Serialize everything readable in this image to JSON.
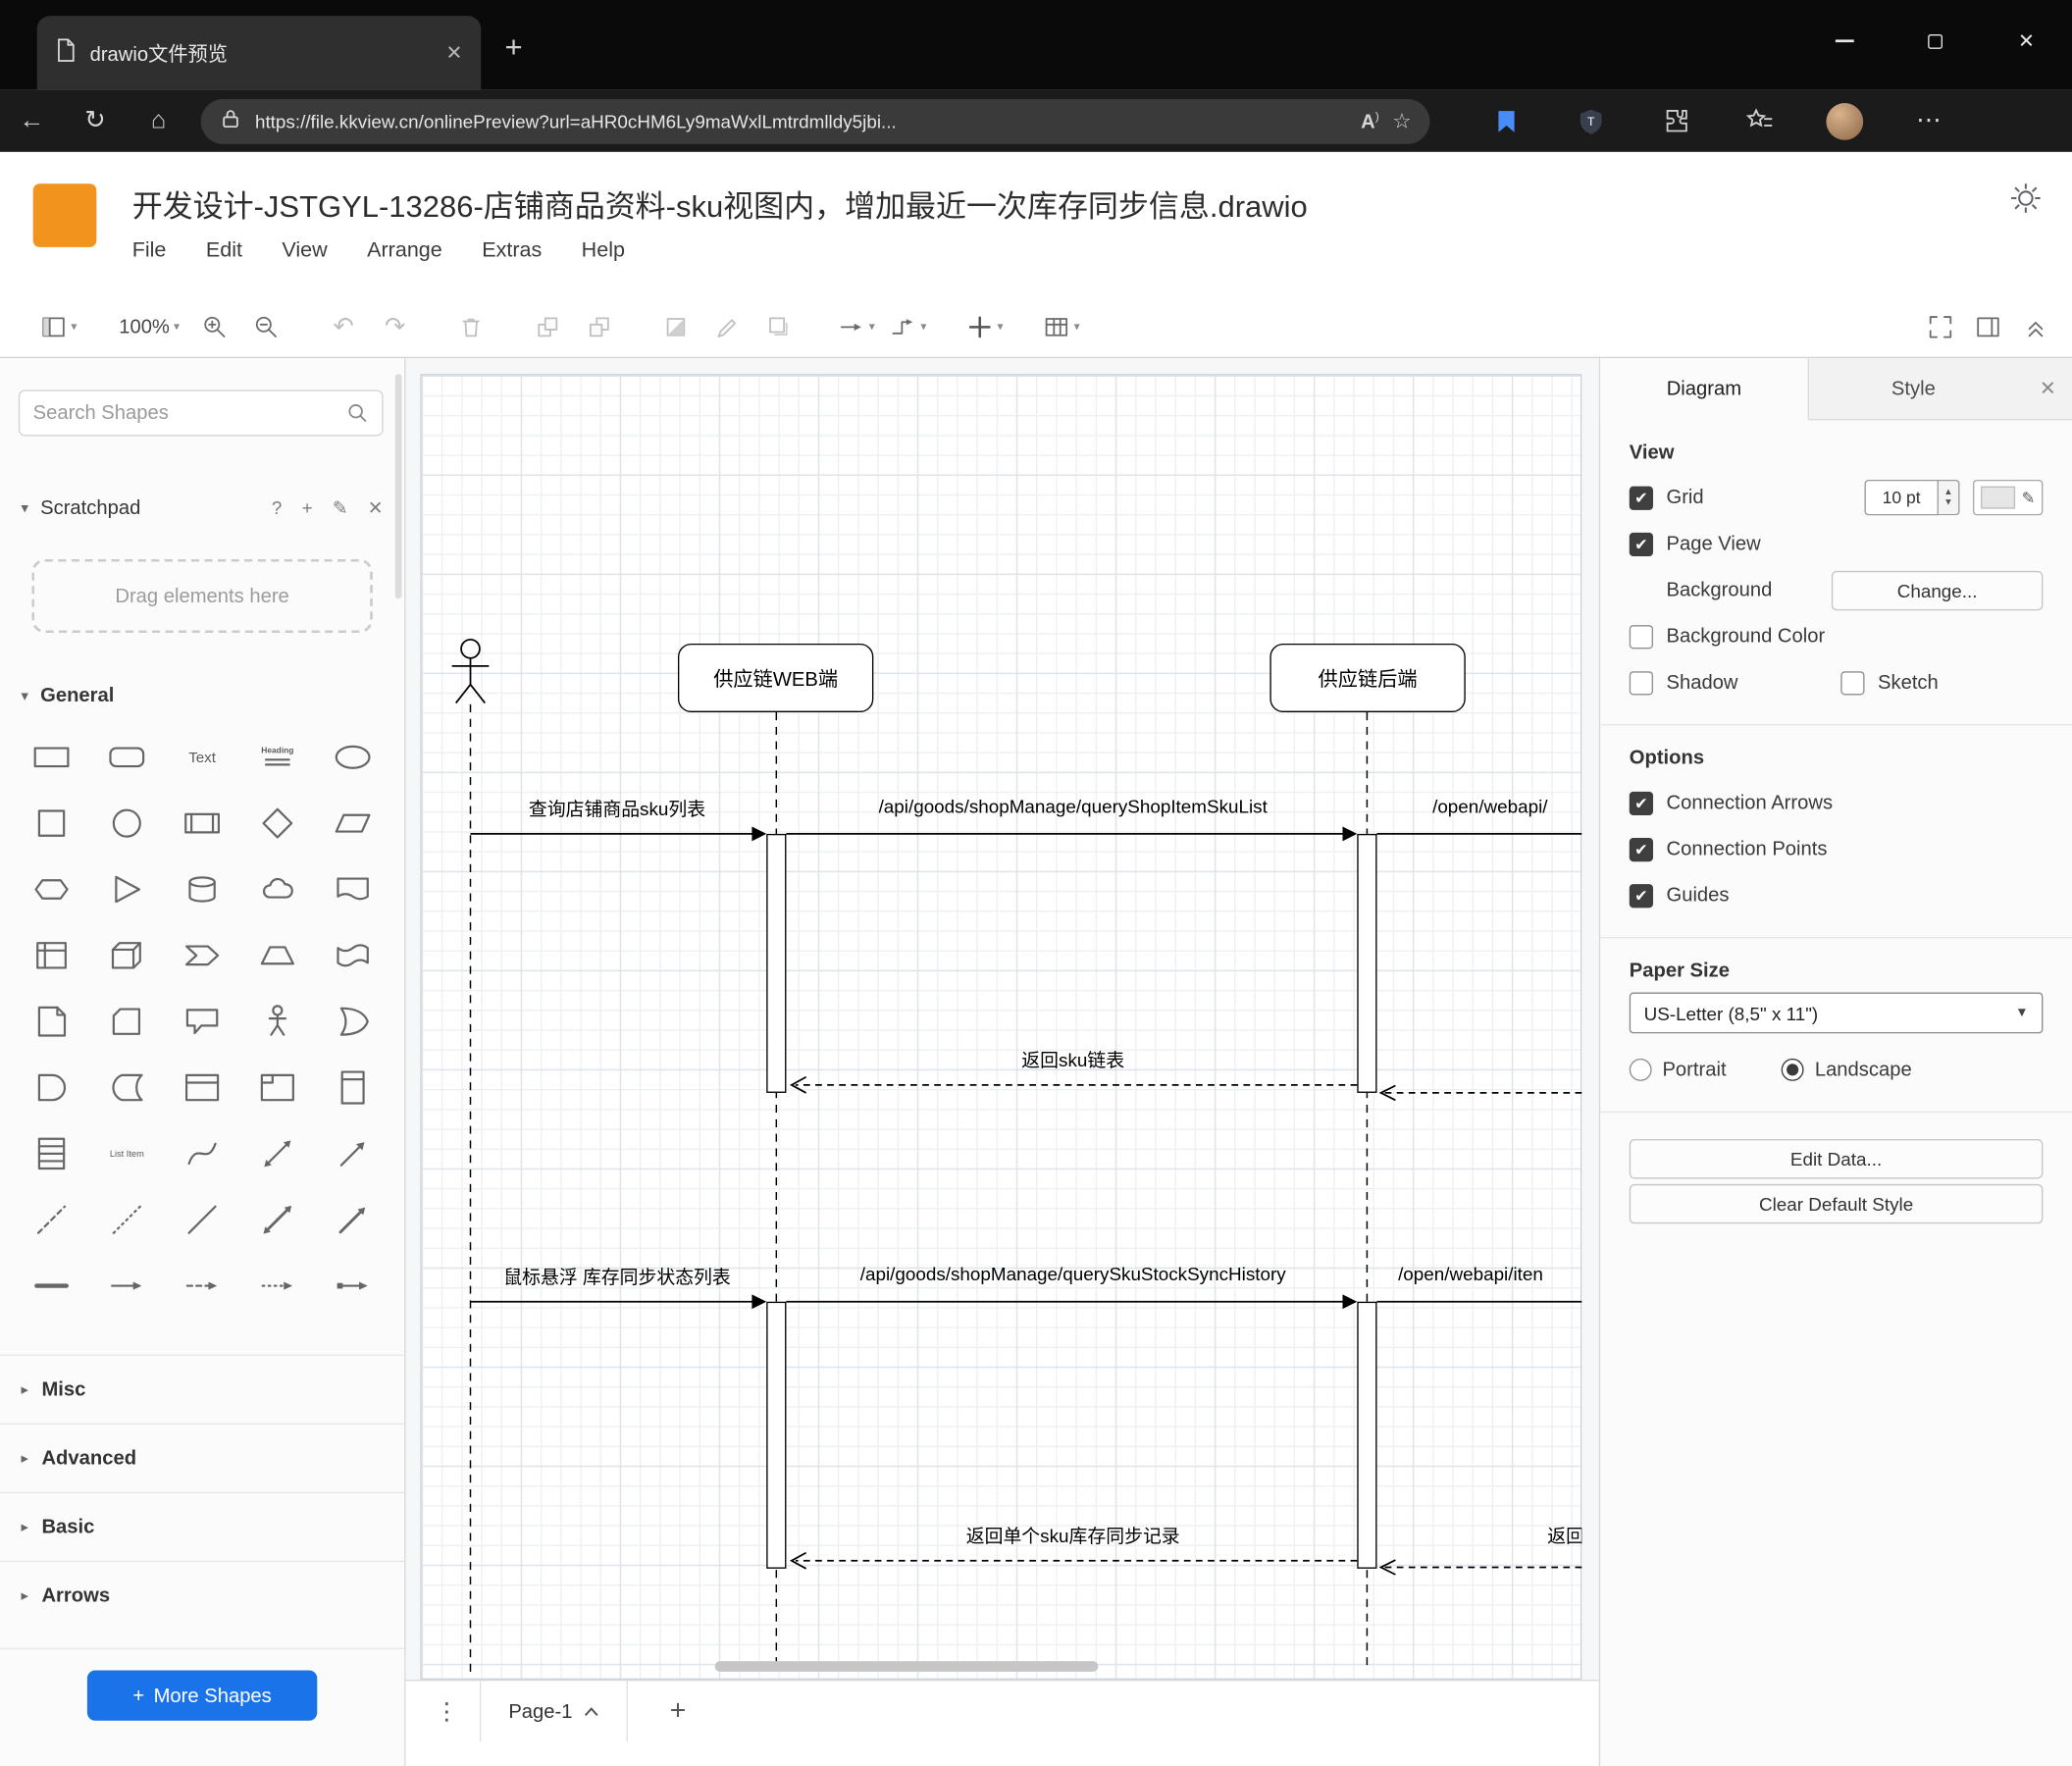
{
  "browser": {
    "tab_title": "drawio文件预览",
    "url": "https://file.kkview.cn/onlinePreview?url=aHR0cHM6Ly9maWxlLmtrdmlldy5jbi..."
  },
  "app": {
    "title": "开发设计-JSTGYL-13286-店铺商品资料-sku视图内，增加最近一次库存同步信息.drawio",
    "menus": [
      "File",
      "Edit",
      "View",
      "Arrange",
      "Extras",
      "Help"
    ]
  },
  "toolbar": {
    "zoom_level": "100%"
  },
  "sidebar": {
    "search_placeholder": "Search Shapes",
    "scratchpad_label": "Scratchpad",
    "scratchpad_hint": "Drag elements here",
    "general_label": "General",
    "collapsed_sections": [
      "Misc",
      "Advanced",
      "Basic",
      "Arrows"
    ],
    "more_shapes_label": "More Shapes",
    "shape_labels": {
      "text": "Text",
      "heading": "Heading",
      "list_item": "List Item"
    },
    "palette": [
      "rectangle",
      "rounded-rectangle",
      "text",
      "heading",
      "ellipse",
      "square",
      "circle",
      "process",
      "diamond",
      "parallelogram",
      "hexagon",
      "triangle",
      "cylinder",
      "cloud",
      "document",
      "internal-storage",
      "cube",
      "step",
      "trapezoid",
      "tape",
      "note",
      "card",
      "callout",
      "actor",
      "or",
      "and",
      "data-storage",
      "container",
      "frame",
      "vertical-container",
      "list",
      "list-item",
      "curve",
      "bidirectional-arrow",
      "arrow",
      "dashed-line",
      "dotted-line",
      "line",
      "double-arrow",
      "directional-arrow",
      "bold-line",
      "horizontal-arrow",
      "dashed-horizontal-arrow",
      "dotted-horizontal-arrow",
      "arrow-with-tail"
    ]
  },
  "canvas": {
    "participants": [
      {
        "label": "供应链WEB端"
      },
      {
        "label": "供应链后端"
      }
    ],
    "messages": [
      {
        "label": "查询店铺商品sku列表",
        "type": "sync"
      },
      {
        "label": "/api/goods/shopManage/queryShopItemSkuList",
        "type": "sync"
      },
      {
        "label": "/open/webapi/",
        "type": "sync"
      },
      {
        "label": "返回sku链表",
        "type": "return"
      },
      {
        "label": "鼠标悬浮 库存同步状态列表",
        "type": "sync"
      },
      {
        "label": "/api/goods/shopManage/querySkuStockSyncHistory",
        "type": "sync"
      },
      {
        "label": "/open/webapi/iten",
        "type": "sync"
      },
      {
        "label": "返回单个sku库存同步记录",
        "type": "return"
      },
      {
        "label": "返回",
        "type": "return"
      }
    ],
    "page_tab": "Page-1"
  },
  "format_panel": {
    "tabs": [
      "Diagram",
      "Style"
    ],
    "view": {
      "header": "View",
      "grid_label": "Grid",
      "grid_checked": true,
      "grid_size": "10 pt",
      "page_view_label": "Page View",
      "page_view_checked": true,
      "background_label": "Background",
      "change_button": "Change...",
      "background_color_label": "Background Color",
      "background_color_checked": false,
      "shadow_label": "Shadow",
      "shadow_checked": false,
      "sketch_label": "Sketch",
      "sketch_checked": false
    },
    "options": {
      "header": "Options",
      "items": [
        "Connection Arrows",
        "Connection Points",
        "Guides"
      ],
      "checked": [
        true,
        true,
        true
      ]
    },
    "paper": {
      "header": "Paper Size",
      "size_value": "US-Letter (8,5\" x 11\")",
      "portrait_label": "Portrait",
      "portrait_checked": false,
      "landscape_label": "Landscape",
      "landscape_checked": true
    },
    "edit_data_button": "Edit Data...",
    "clear_style_button": "Clear Default Style"
  },
  "colors": {
    "accent_blue": "#1a73e8",
    "logo_orange": "#f2931e"
  }
}
